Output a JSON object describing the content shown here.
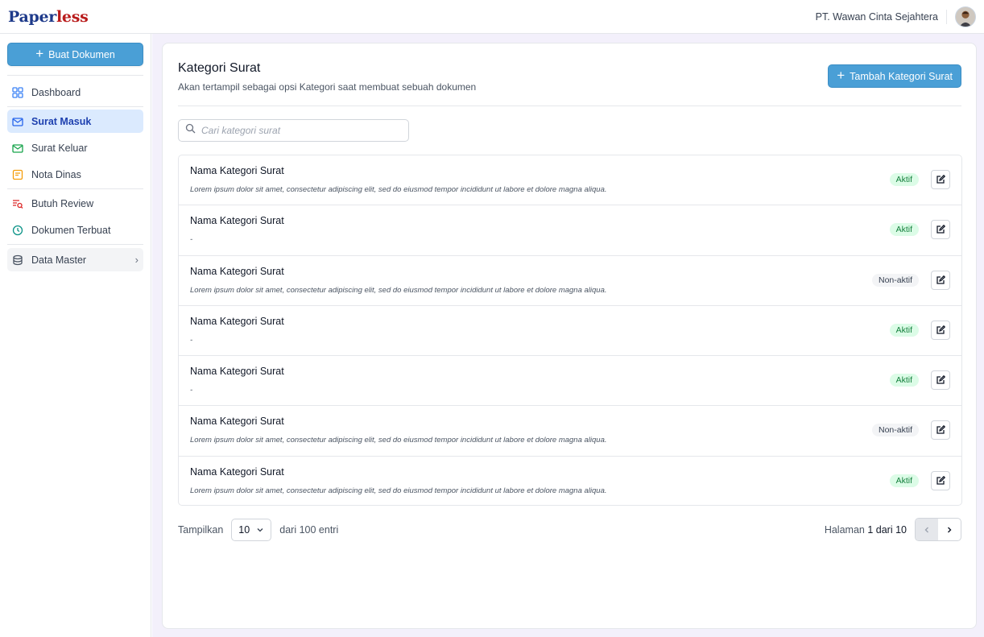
{
  "brand": {
    "prefix": "Paper",
    "suffix": "less"
  },
  "header": {
    "organization": "PT. Wawan Cinta Sejahtera"
  },
  "sidebar": {
    "create_button": "Buat Dokumen",
    "items": [
      {
        "label": "Dashboard",
        "icon": "dashboard-icon",
        "color": "#3b82f6"
      },
      {
        "label": "Surat Masuk",
        "icon": "mail-in-icon",
        "color": "#2563eb",
        "active": true
      },
      {
        "label": "Surat Keluar",
        "icon": "mail-out-icon",
        "color": "#16a34a"
      },
      {
        "label": "Nota Dinas",
        "icon": "note-icon",
        "color": "#f59e0b"
      },
      {
        "label": "Butuh Review",
        "icon": "review-icon",
        "color": "#dc2626"
      },
      {
        "label": "Dokumen Terbuat",
        "icon": "history-icon",
        "color": "#0d9488"
      },
      {
        "label": "Data Master",
        "icon": "database-icon",
        "color": "#4b5563"
      }
    ]
  },
  "page": {
    "title": "Kategori Surat",
    "subtitle": "Akan tertampil sebagai opsi Kategori saat membuat sebuah dokumen",
    "add_button": "Tambah Kategori Surat",
    "search_placeholder": "Cari kategori surat"
  },
  "categories": [
    {
      "name": "Nama Kategori Surat",
      "description": "Lorem ipsum dolor sit amet, consectetur adipiscing elit, sed do eiusmod tempor incididunt ut labore et dolore magna aliqua.",
      "status": "Aktif"
    },
    {
      "name": "Nama Kategori Surat",
      "description": "-",
      "status": "Aktif"
    },
    {
      "name": "Nama Kategori Surat",
      "description": "Lorem ipsum dolor sit amet, consectetur adipiscing elit, sed do eiusmod tempor incididunt ut labore et dolore magna aliqua.",
      "status": "Non-aktif"
    },
    {
      "name": "Nama Kategori Surat",
      "description": "-",
      "status": "Aktif"
    },
    {
      "name": "Nama Kategori Surat",
      "description": "-",
      "status": "Aktif"
    },
    {
      "name": "Nama Kategori Surat",
      "description": "Lorem ipsum dolor sit amet, consectetur adipiscing elit, sed do eiusmod tempor incididunt ut labore et dolore magna aliqua.",
      "status": "Non-aktif"
    },
    {
      "name": "Nama Kategori Surat",
      "description": "Lorem ipsum dolor sit amet, consectetur adipiscing elit, sed do eiusmod tempor incididunt ut labore et dolore magna aliqua.",
      "status": "Aktif"
    }
  ],
  "footer": {
    "show_label": "Tampilkan",
    "page_size": "10",
    "total_label": "dari 100 entri",
    "page_label": "Halaman",
    "page_value": "1 dari 10"
  },
  "colors": {
    "accent": "#4a9fd6",
    "active_badge": "#dcfce7",
    "inactive_badge": "#f3f4f6"
  }
}
